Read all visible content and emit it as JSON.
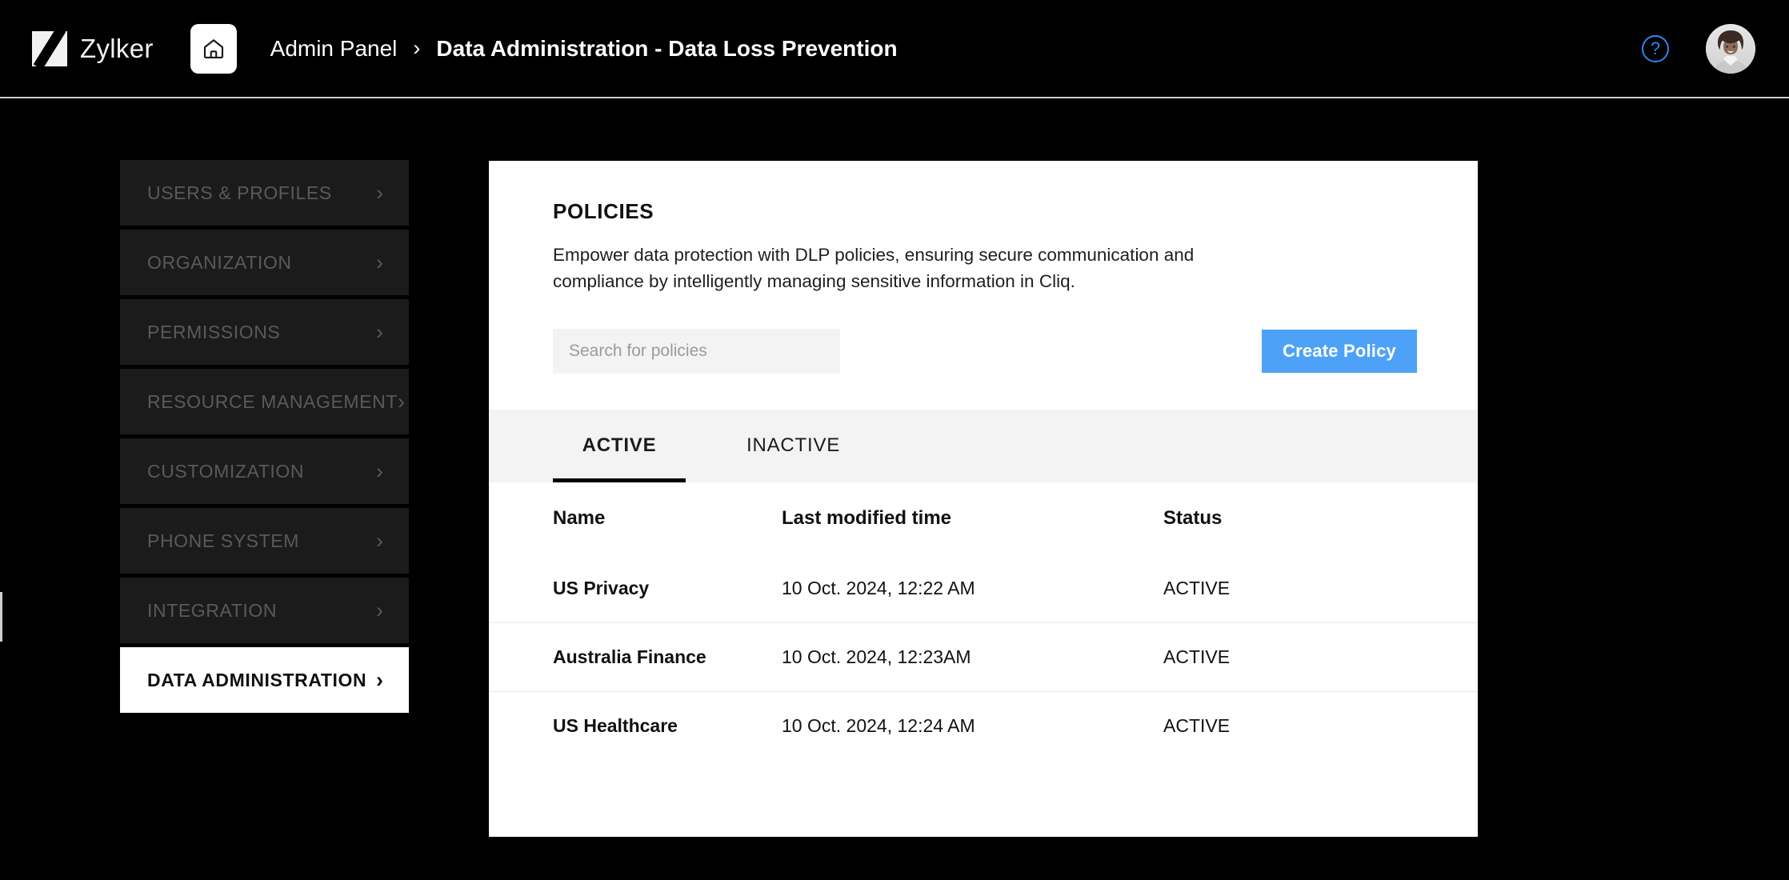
{
  "header": {
    "brand_name": "Zylker",
    "home_icon": "home-icon",
    "breadcrumb_root": "Admin Panel",
    "breadcrumb_separator": "›",
    "breadcrumb_current": "Data Administration - Data Loss Prevention",
    "help_label": "?",
    "help_icon": "question-circle-icon",
    "avatar_icon": "user-avatar"
  },
  "sidebar": {
    "chevron": "›",
    "items": [
      {
        "label": "USERS & PROFILES",
        "active": false
      },
      {
        "label": "ORGANIZATION",
        "active": false
      },
      {
        "label": "PERMISSIONS",
        "active": false
      },
      {
        "label": "RESOURCE MANAGEMENT",
        "active": false
      },
      {
        "label": "CUSTOMIZATION",
        "active": false
      },
      {
        "label": "PHONE SYSTEM",
        "active": false
      },
      {
        "label": "INTEGRATION",
        "active": false
      },
      {
        "label": "DATA ADMINISTRATION",
        "active": true
      }
    ]
  },
  "main": {
    "title": "POLICIES",
    "description": "Empower data protection with DLP policies, ensuring secure communication and compliance by intelligently managing sensitive information in Cliq.",
    "search": {
      "placeholder": "Search for policies",
      "value": ""
    },
    "create_button": "Create Policy",
    "tabs": [
      {
        "label": "ACTIVE",
        "selected": true
      },
      {
        "label": "INACTIVE",
        "selected": false
      }
    ],
    "table": {
      "columns": [
        "Name",
        "Last modified time",
        "Status"
      ],
      "rows": [
        {
          "name": "US Privacy",
          "modified": "10 Oct. 2024, 12:22 AM",
          "status": "ACTIVE"
        },
        {
          "name": "Australia Finance",
          "modified": "10 Oct. 2024, 12:23AM",
          "status": "ACTIVE"
        },
        {
          "name": "US Healthcare",
          "modified": "10 Oct. 2024, 12:24 AM",
          "status": "ACTIVE"
        }
      ]
    }
  },
  "colors": {
    "page_background": "#000000",
    "card_background": "#ffffff",
    "accent_blue": "#4da2f7",
    "help_blue": "#2e86f0",
    "nav_item_background": "#1b1b1b",
    "nav_item_text": "#5a5a5a",
    "tabbar_background": "#f3f3f3"
  }
}
